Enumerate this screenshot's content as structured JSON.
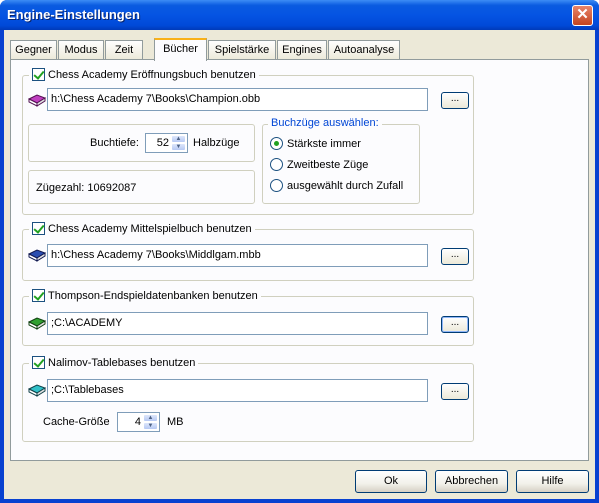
{
  "window": {
    "title": "Engine-Einstellungen",
    "close_glyph": "✕"
  },
  "tabs": [
    {
      "label": "Gegner"
    },
    {
      "label": "Modus"
    },
    {
      "label": "Zeit"
    },
    {
      "label": "Bücher"
    },
    {
      "label": "Spielstärke"
    },
    {
      "label": "Engines"
    },
    {
      "label": "Autoanalyse"
    }
  ],
  "opening_book": {
    "label": "Chess Academy Eröffnungsbuch benutzen",
    "checked": true,
    "path": "h:\\Chess Academy 7\\Books\\Champion.obb",
    "browse": "...",
    "icon_color": "#c040c0",
    "depth_label": "Buchtiefe:",
    "depth_value": "52",
    "depth_unit": "Halbzüge",
    "move_count": "Zügezahl: 10692087",
    "selection_title": "Buchzüge auswählen:",
    "options": [
      "Stärkste immer",
      "Zweitbeste Züge",
      "ausgewählt durch Zufall"
    ],
    "selected_option": "Stärkste immer"
  },
  "middlegame_book": {
    "label": "Chess Academy Mittelspielbuch benutzen",
    "checked": true,
    "path": "h:\\Chess Academy 7\\Books\\Middlgam.mbb",
    "browse": "...",
    "icon_color": "#2a4db0"
  },
  "endgame_db": {
    "label": "Thompson-Endspieldatenbanken benutzen",
    "checked": true,
    "path": ";C:\\ACADEMY",
    "browse": "...",
    "icon_color": "#30a030"
  },
  "tablebases": {
    "label": "Nalimov-Tablebases benutzen",
    "checked": true,
    "path": ";C:\\Tablebases",
    "browse": "...",
    "icon_color": "#30c0c8",
    "cache_label": "Cache-Größe",
    "cache_value": "4",
    "cache_unit": "MB"
  },
  "buttons": {
    "ok": "Ok",
    "cancel": "Abbrechen",
    "help": "Hilfe"
  }
}
